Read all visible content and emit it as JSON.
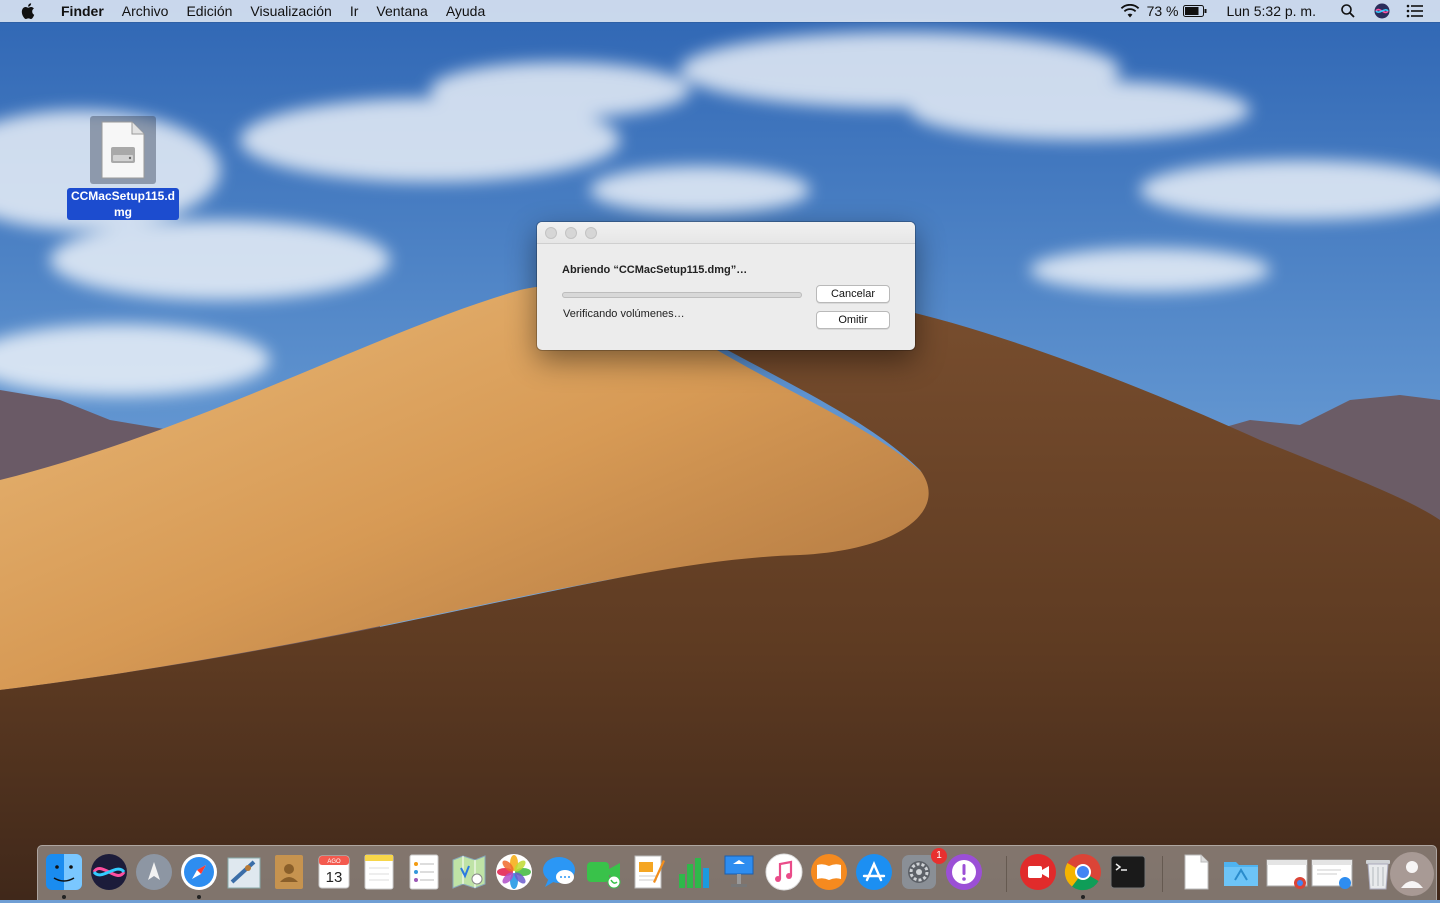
{
  "menubar": {
    "app_name": "Finder",
    "menus": [
      "Archivo",
      "Edición",
      "Visualización",
      "Ir",
      "Ventana",
      "Ayuda"
    ],
    "battery": "73 %",
    "clock": "Lun 5:32 p. m.",
    "icons": [
      "apple-icon",
      "wifi-icon",
      "battery-icon",
      "spotlight-icon",
      "siri-icon",
      "notification-center-icon"
    ]
  },
  "desktop": {
    "file_name": "CCMacSetup115.dmg",
    "file_icon": "disk-image-icon"
  },
  "dialog": {
    "title": "Abriendo “CCMacSetup115.dmg”…",
    "status": "Verificando volúmenes…",
    "progress": 0,
    "cancel_label": "Cancelar",
    "skip_label": "Omitir"
  },
  "dock": {
    "calendar_month": "AGO",
    "calendar_day": "13",
    "badge_count": "1",
    "apps": [
      "finder",
      "siri",
      "launchpad",
      "safari",
      "mail",
      "contacts",
      "calendar",
      "notes",
      "reminders",
      "maps",
      "photos",
      "messages",
      "facetime",
      "pages",
      "numbers",
      "keynote",
      "itunes",
      "ibooks",
      "app-store",
      "system-preferences",
      "feedback",
      "zoom",
      "chrome",
      "terminal",
      "document",
      "downloads-folder",
      "window-chrome",
      "window-safari",
      "trash"
    ]
  }
}
